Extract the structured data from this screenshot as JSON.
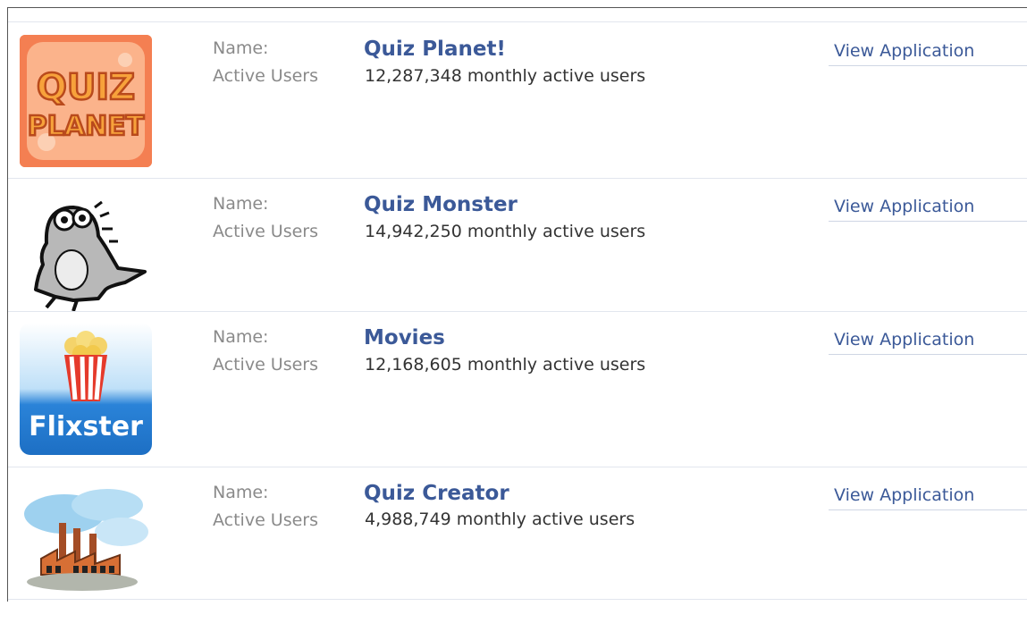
{
  "labels": {
    "name": "Name:",
    "active_users": "Active Users"
  },
  "apps": [
    {
      "name": "Quiz Planet!",
      "users": "12,287,348 monthly active users",
      "action": "View Application",
      "icon": "quiz-planet-logo",
      "logo_lines": [
        "QUIZ",
        "PLANET"
      ]
    },
    {
      "name": "Quiz Monster",
      "users": "14,942,250 monthly active users",
      "action": "View Application",
      "icon": "monster-cartoon"
    },
    {
      "name": "Movies",
      "users": "12,168,605 monthly active users",
      "action": "View Application",
      "icon": "flixster-logo",
      "logo_text": "Flixster"
    },
    {
      "name": "Quiz Creator",
      "users": "4,988,749 monthly active users",
      "action": "View Application",
      "icon": "factory-picture"
    }
  ],
  "colors": {
    "link": "#3b5998",
    "label": "#8a8a8a",
    "text": "#333333"
  }
}
